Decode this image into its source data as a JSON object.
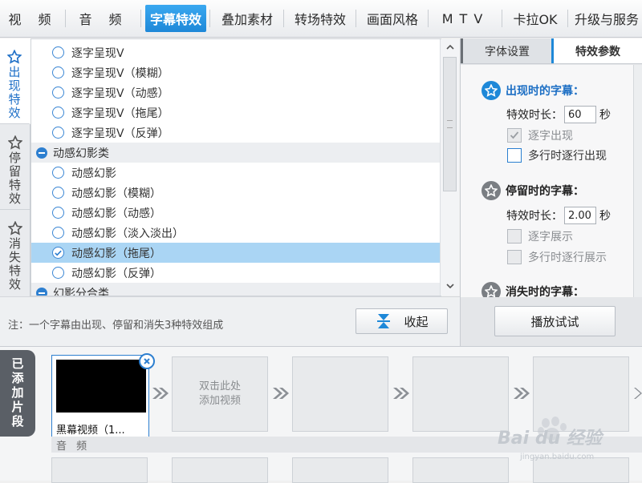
{
  "top_tabs": [
    {
      "label": "视 频",
      "active": false
    },
    {
      "label": "音 频",
      "active": false
    },
    {
      "label": "字幕特效",
      "active": true
    },
    {
      "label": "叠加素材",
      "active": false
    },
    {
      "label": "转场特效",
      "active": false
    },
    {
      "label": "画面风格",
      "active": false
    },
    {
      "label": "MTV",
      "active": false
    },
    {
      "label": "卡拉OK",
      "active": false
    },
    {
      "label": "升级与服务",
      "active": false
    }
  ],
  "side_tabs": [
    {
      "label": "出现特效",
      "active": true,
      "icon": "star-outline-icon"
    },
    {
      "label": "停留特效",
      "active": false,
      "icon": "star-outline-icon"
    },
    {
      "label": "消失特效",
      "active": false,
      "icon": "star-outline-icon"
    }
  ],
  "effect_list": {
    "items": [
      {
        "label": "逐字呈现V",
        "type": "item",
        "selected": false
      },
      {
        "label": "逐字呈现V（模糊）",
        "type": "item",
        "selected": false
      },
      {
        "label": "逐字呈现V（动感）",
        "type": "item",
        "selected": false
      },
      {
        "label": "逐字呈现V（拖尾）",
        "type": "item",
        "selected": false
      },
      {
        "label": "逐字呈现V（反弹）",
        "type": "item",
        "selected": false
      },
      {
        "label": "动感幻影类",
        "type": "group",
        "selected": false
      },
      {
        "label": "动感幻影",
        "type": "item",
        "selected": false
      },
      {
        "label": "动感幻影（模糊）",
        "type": "item",
        "selected": false
      },
      {
        "label": "动感幻影（动感）",
        "type": "item",
        "selected": false
      },
      {
        "label": "动感幻影（淡入淡出）",
        "type": "item",
        "selected": false
      },
      {
        "label": "动感幻影（拖尾）",
        "type": "item",
        "selected": true
      },
      {
        "label": "动感幻影（反弹）",
        "type": "item",
        "selected": false
      },
      {
        "label": "幻影分合类",
        "type": "group",
        "selected": false
      }
    ]
  },
  "note": "注：一个字幕由出现、停留和消失3种特效组成",
  "collapse_label": "收起",
  "play_label": "播放试试",
  "settings": {
    "tabs": [
      "字体设置",
      "特效参数"
    ],
    "active_tab": 1,
    "appear": {
      "title": "出现时的字幕：",
      "duration_label": "特效时长：",
      "duration_value": "60",
      "unit": "秒",
      "opt1": "逐字出现",
      "opt1_checked": true,
      "opt1_disabled": true,
      "opt2": "多行时逐行出现",
      "opt2_checked": false,
      "opt2_disabled": false
    },
    "stay": {
      "title": "停留时的字幕：",
      "duration_label": "特效时长：",
      "duration_value": "2.00",
      "unit": "秒",
      "opt1": "逐字展示",
      "opt2": "多行时逐行展示"
    },
    "vanish": {
      "title": "消失时的字幕："
    }
  },
  "timeline": {
    "added_label": "已添加片段",
    "clip_caption": "黑幕视频（1...",
    "add_hint_line1": "双击此处",
    "add_hint_line2": "添加视频",
    "audio_label": "音 频"
  },
  "watermark": {
    "text": "Bai du 经验",
    "sub": "jingyan.baidu.com"
  },
  "colors": {
    "accent": "#1e88d8",
    "selected_row": "#aad5f4",
    "group_row": "#eceef1"
  }
}
